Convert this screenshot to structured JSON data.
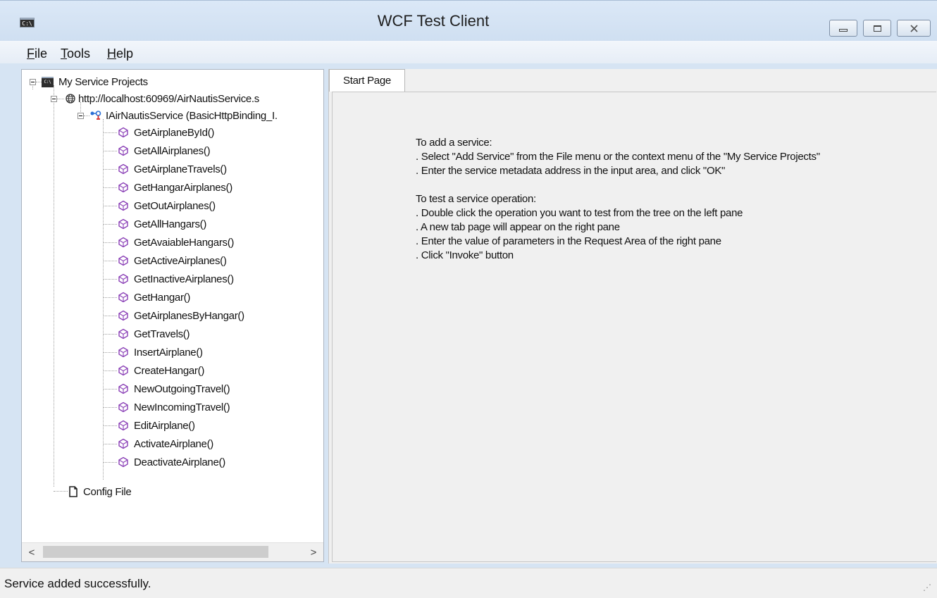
{
  "window": {
    "title": "WCF Test Client",
    "icon_text": "C:\\",
    "buttons": [
      "minimize",
      "maximize",
      "close"
    ]
  },
  "menu": [
    {
      "label": "File",
      "mnemonic": "F",
      "rest": "ile"
    },
    {
      "label": "Tools",
      "mnemonic": "T",
      "rest": "ools"
    },
    {
      "label": "Help",
      "mnemonic": "H",
      "rest": "elp"
    }
  ],
  "tree": {
    "root": "My Service Projects",
    "service_url": "http://localhost:60969/AirNautisService.s",
    "contract": "IAirNautisService (BasicHttpBinding_I.",
    "operations": [
      "GetAirplaneById()",
      "GetAllAirplanes()",
      "GetAirplaneTravels()",
      "GetHangarAirplanes()",
      "GetOutAirplanes()",
      "GetAllHangars()",
      "GetAvaiableHangars()",
      "GetActiveAirplanes()",
      "GetInactiveAirplanes()",
      "GetHangar()",
      "GetAirplanesByHangar()",
      "GetTravels()",
      "InsertAirplane()",
      "CreateHangar()",
      "NewOutgoingTravel()",
      "NewIncomingTravel()",
      "EditAirplane()",
      "ActivateAirplane()",
      "DeactivateAirplane()"
    ],
    "config_file": "Config File"
  },
  "scroll_arrows": {
    "left": "<",
    "right": ">"
  },
  "tabs": [
    {
      "label": "Start Page",
      "active": true
    }
  ],
  "start_page": {
    "add_heading": "To add a service:",
    "add_steps": [
      ". Select \"Add Service\" from the File menu or the context menu of the \"My Service Projects\"",
      ". Enter the service metadata address in the input area, and click \"OK\""
    ],
    "test_heading": "To test a service operation:",
    "test_steps": [
      ". Double click the operation you want to test from the tree on the left pane",
      ". A new tab page will appear on the right pane",
      ". Enter the value of parameters in the Request Area of the right pane",
      ". Click \"Invoke\" button"
    ]
  },
  "status": {
    "text": "Service added successfully."
  },
  "colors": {
    "operation_icon": "#8a3fb6",
    "service_icon": "#2a6fd6",
    "title_bar": "#d3e2f3"
  }
}
